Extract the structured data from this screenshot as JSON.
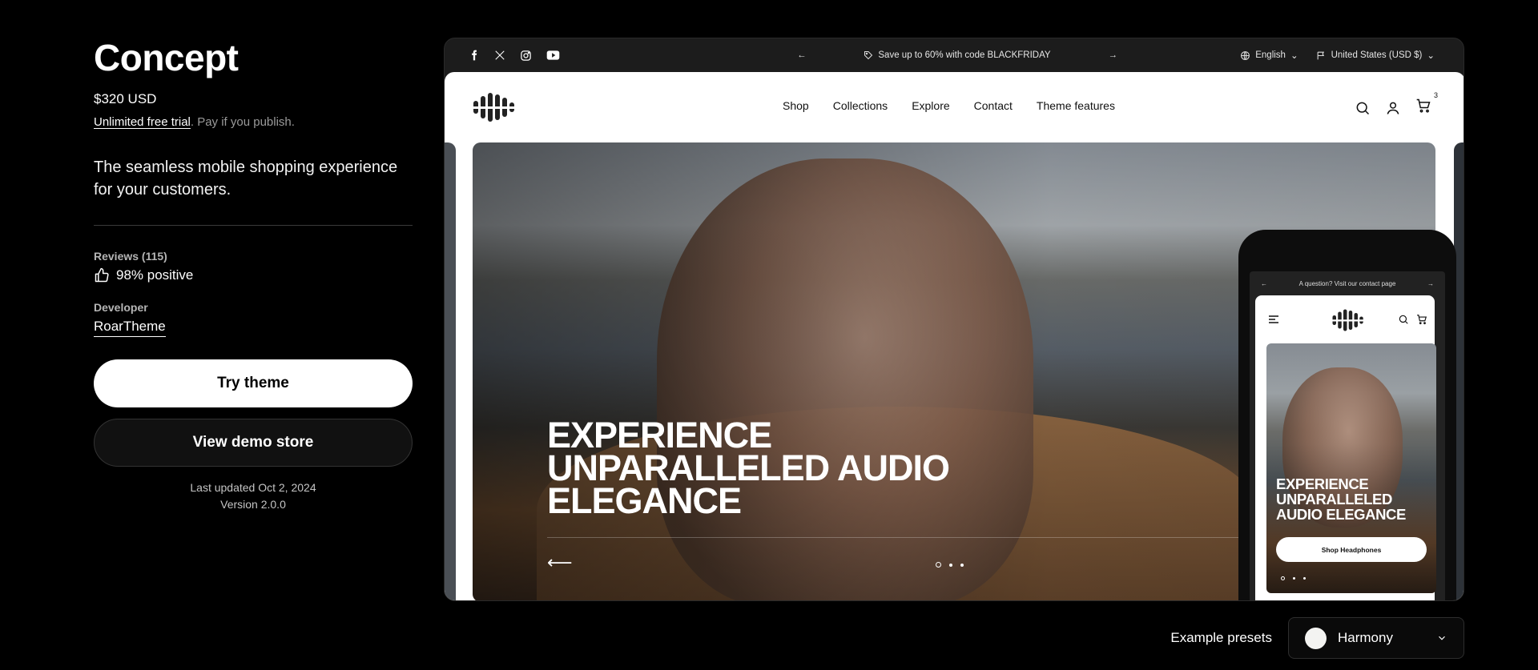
{
  "theme": {
    "title": "Concept",
    "price": "$320 USD",
    "trial_link": "Unlimited free trial",
    "trial_rest": ". Pay if you publish.",
    "tagline": "The seamless mobile shopping experience for your customers.",
    "reviews_label": "Reviews (115)",
    "reviews_positive": "98% positive",
    "developer_label": "Developer",
    "developer_name": "RoarTheme",
    "try_button": "Try theme",
    "demo_button": "View demo store",
    "last_updated": "Last updated Oct 2, 2024",
    "version": "Version 2.0.0"
  },
  "preview": {
    "announcement": "Save up to 60% with code BLACKFRIDAY",
    "language": "English",
    "currency": "United States (USD $)",
    "nav": [
      "Shop",
      "Collections",
      "Explore",
      "Contact",
      "Theme features"
    ],
    "cart_count": "3",
    "hero_title_lines": [
      "EXPERIENCE",
      "UNPARALLELED AUDIO",
      "ELEGANCE"
    ],
    "mobile": {
      "announcement": "A question? Visit our contact page",
      "hero_title_lines": [
        "EXPERIENCE",
        "UNPARALLELED",
        "AUDIO ELEGANCE"
      ],
      "button": "Shop Headphones"
    }
  },
  "presets": {
    "label": "Example presets",
    "selected": "Harmony",
    "swatch_color": "#f3f3f1"
  }
}
